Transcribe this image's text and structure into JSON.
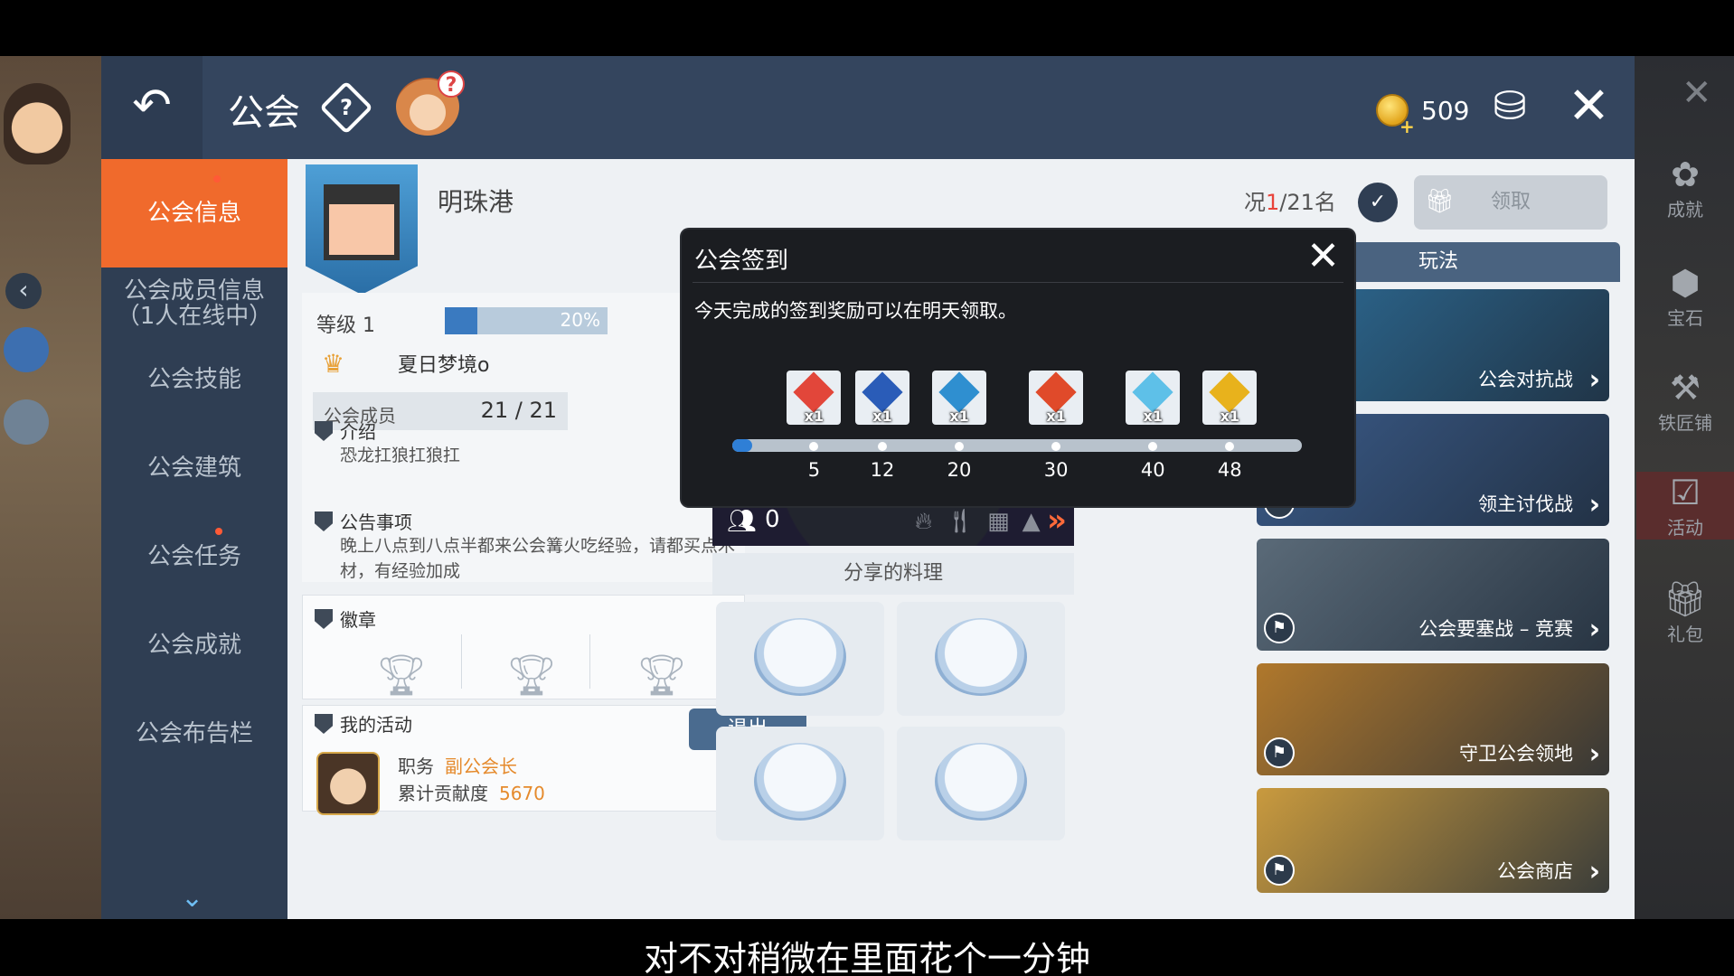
{
  "window": {
    "title": "公会",
    "coins": "509"
  },
  "icons": {
    "back": "back-arrow-icon",
    "help": "help-diamond-icon",
    "coin": "gold-coin-icon",
    "exchange": "currency-exchange-icon",
    "close": "close-icon"
  },
  "nav": {
    "items": [
      {
        "label": "公会信息"
      },
      {
        "label": "公会成员信息\n（1人在线中）"
      },
      {
        "label": "公会技能"
      },
      {
        "label": "公会建筑"
      },
      {
        "label": "公会任务"
      },
      {
        "label": "公会成就"
      },
      {
        "label": "公会布告栏"
      }
    ]
  },
  "guild": {
    "name": "明珠港",
    "level_label": "等级 1",
    "level_percent": "20%",
    "level_fraction": 0.2,
    "leader": "夏日梦境o",
    "members_label": "公会成员",
    "members_value": "21 / 21",
    "intro_title": "介绍",
    "intro_text": "恐龙扛狼扛狼扛",
    "notice_title": "公告事项",
    "notice_text": "晚上八点到八点半都来公会篝火吃经验，请都买点木材，有经验加成",
    "badge_title": "徽章",
    "activity_title": "我的活动",
    "quit_label": "退出",
    "role_label": "职务",
    "role_value": "副公会长",
    "contrib_label": "累计贡献度",
    "contrib_value": "5670"
  },
  "campfire": {
    "people": "0",
    "share_title": "分享的料理"
  },
  "right": {
    "rank_prefix": "况",
    "rank_current": "1",
    "rank_suffix": "/21名",
    "claim_label": "领取",
    "play_header": "玩法",
    "cards": [
      {
        "label": "公会对抗战",
        "color": "#2d6c96"
      },
      {
        "label": "领主讨伐战",
        "color": "#3a5a88"
      },
      {
        "label": "公会要塞战 – 竞赛",
        "color": "#5a6a78"
      },
      {
        "label": "守卫公会领地",
        "color": "#b0782c"
      },
      {
        "label": "公会商店",
        "color": "#c99a3e"
      }
    ]
  },
  "side_right": {
    "items": [
      "成就",
      "宝石",
      "铁匠铺",
      "活动",
      "礼包"
    ]
  },
  "dialog": {
    "title": "公会签到",
    "description": "今天完成的签到奖励可以在明天领取。",
    "progress_fraction": 0.02,
    "milestones": [
      {
        "value": "5",
        "qty": "x1",
        "color": "#e2463a"
      },
      {
        "value": "12",
        "qty": "x1",
        "color": "#2a5cb8"
      },
      {
        "value": "20",
        "qty": "x1",
        "color": "#2f8fd0"
      },
      {
        "value": "30",
        "qty": "x1",
        "color": "#e04a2a"
      },
      {
        "value": "40",
        "qty": "x1",
        "color": "#5ec0e8"
      },
      {
        "value": "48",
        "qty": "x1",
        "color": "#e8b21c"
      }
    ]
  },
  "subtitle": "对不对稍微在里面花个一分钟"
}
